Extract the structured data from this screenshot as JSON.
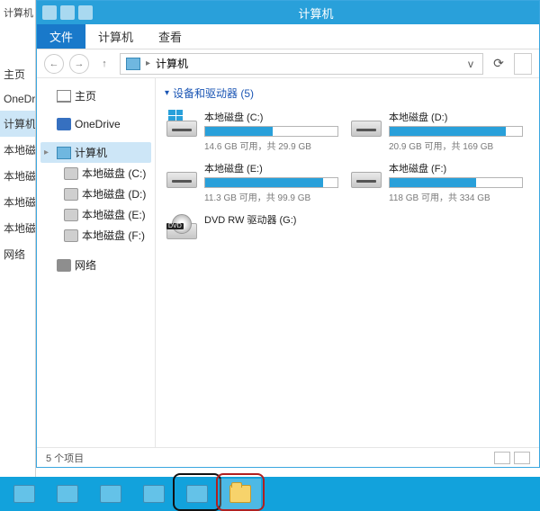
{
  "window": {
    "title": "计算机"
  },
  "ribbon": {
    "file": "文件",
    "computer": "计算机",
    "view": "查看"
  },
  "nav": {
    "back_glyph": "←",
    "fwd_glyph": "→",
    "up_glyph": "↑",
    "refresh_glyph": "⟳",
    "dropdown_glyph": "v",
    "breadcrumb_sep": "▸",
    "location": "计算机"
  },
  "tree": {
    "home": "主页",
    "onedrive": "OneDrive",
    "computer": "计算机",
    "drives": [
      {
        "label": "本地磁盘 (C:)"
      },
      {
        "label": "本地磁盘 (D:)"
      },
      {
        "label": "本地磁盘 (E:)"
      },
      {
        "label": "本地磁盘 (F:)"
      }
    ],
    "network": "网络"
  },
  "bgtree": {
    "home": "主页",
    "onedrive": "OneDrive",
    "computer": "计算机",
    "c": "本地磁",
    "d": "本地磁",
    "e": "本地磁",
    "f": "本地磁",
    "network": "网络"
  },
  "content": {
    "group_header": "设备和驱动器 (5)",
    "caret": "▾",
    "drives": [
      {
        "name": "本地磁盘 (C:)",
        "free": "14.6 GB",
        "total": "29.9 GB",
        "used_pct": 51,
        "is_os": true
      },
      {
        "name": "本地磁盘 (D:)",
        "free": "20.9 GB",
        "total": "169 GB",
        "used_pct": 88,
        "is_os": false
      },
      {
        "name": "本地磁盘 (E:)",
        "free": "11.3 GB",
        "total": "99.9 GB",
        "used_pct": 89,
        "is_os": false
      },
      {
        "name": "本地磁盘 (F:)",
        "free": "118 GB",
        "total": "334 GB",
        "used_pct": 65,
        "is_os": false
      }
    ],
    "optical": {
      "name": "DVD RW 驱动器 (G:)"
    },
    "space_template": "{free} 可用，共 {total}"
  },
  "statusbar": {
    "items": "5 个项目"
  },
  "bg_title": "计算机"
}
